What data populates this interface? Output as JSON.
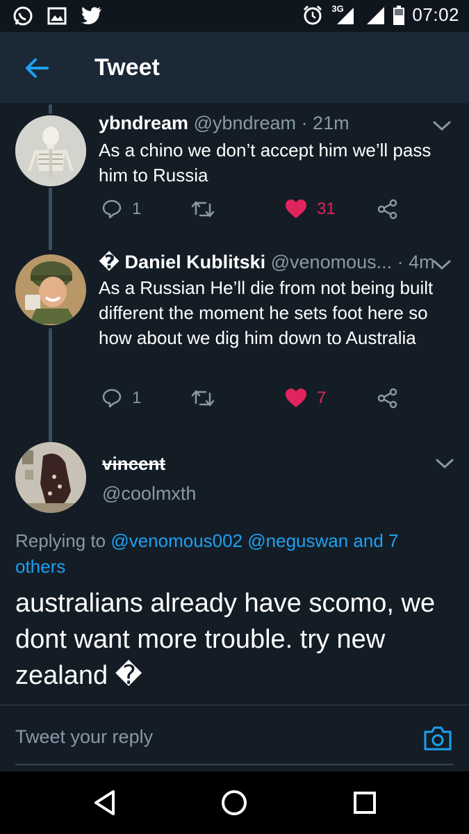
{
  "status_bar": {
    "time": "07:02",
    "network": "3G",
    "left_icons": [
      "whatsapp-icon",
      "gallery-icon",
      "twitter-icon"
    ],
    "right_icons": [
      "alarm-icon",
      "signal-icon",
      "signal-icon",
      "battery-icon"
    ]
  },
  "header": {
    "title": "Tweet"
  },
  "tweets": [
    {
      "name": "ybndream",
      "handle": "@ybndream",
      "time": "· 21m",
      "text": "As a chino we don’t accept him we’ll pass him to Russia",
      "replies": "1",
      "retweets": "",
      "likes": "31",
      "liked": true
    },
    {
      "name": "� Daniel Kublitski",
      "handle": "@venomous...",
      "time": "· 4m",
      "text": "As a Russian He’ll die from not being built different the moment he sets foot here so how about we dig him down to Australia",
      "replies": "1",
      "retweets": "",
      "likes": "7",
      "liked": true
    }
  ],
  "focused_tweet": {
    "name": "vincent",
    "handle": "@coolmxth",
    "replying_prefix": "Replying to",
    "replying_links": "@venomous002 @neguswan and 7 others",
    "text": "australians already have scomo, we dont want more trouble. try new zealand �"
  },
  "reply_bar": {
    "placeholder": "Tweet your reply"
  },
  "colors": {
    "background": "#141d26",
    "header": "#1b2836",
    "accent": "#1da1f2",
    "like": "#e0245e",
    "muted": "#8899a6"
  }
}
